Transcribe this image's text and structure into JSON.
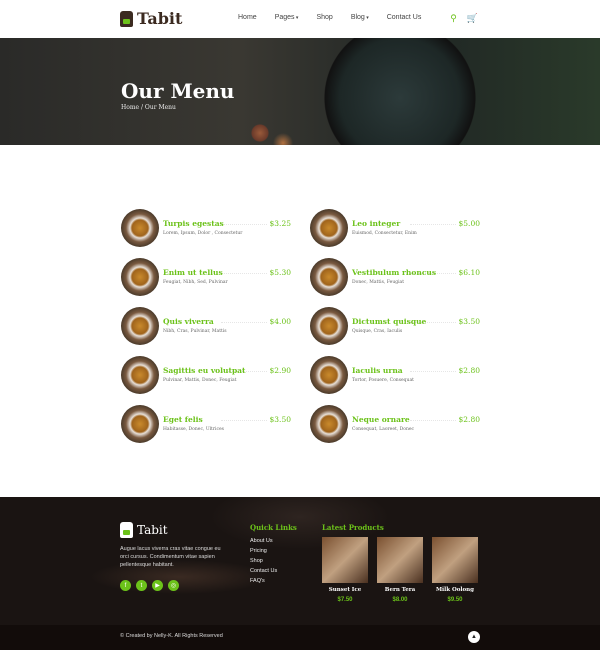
{
  "header": {
    "brand": "Tabit",
    "nav": [
      "Home",
      "Pages",
      "Shop",
      "Blog",
      "Contact Us"
    ],
    "icons": [
      "search-icon",
      "cart-icon"
    ]
  },
  "hero": {
    "title": "Our Menu",
    "breadcrumb": "Home / Our Menu"
  },
  "menu": [
    {
      "name": "Turpis egestas",
      "price": "$3.25",
      "desc": "Lorem, Ipsum, Dolor , Consectetur"
    },
    {
      "name": "Leo integer",
      "price": "$5.00",
      "desc": "Euismod, Consectetur, Enim"
    },
    {
      "name": "Enim ut tellus",
      "price": "$5.30",
      "desc": "Feugiat, Nibh, Sed, Pulvinar"
    },
    {
      "name": "Vestibulum rhoncus",
      "price": "$6.10",
      "desc": "Donec, Mattis, Feugiat"
    },
    {
      "name": "Quis viverra",
      "price": "$4.00",
      "desc": "Nibh, Cras, Pulvinar, Mattis"
    },
    {
      "name": "Dictumst quisque",
      "price": "$3.50",
      "desc": "Quisque, Cras, Iaculis"
    },
    {
      "name": "Sagittis eu volutpat",
      "price": "$2.90",
      "desc": "Pulvinar, Mattis, Donec, Feugiat"
    },
    {
      "name": "Iaculis urna",
      "price": "$2.80",
      "desc": "Tortor, Posuere, Consequat"
    },
    {
      "name": "Eget felis",
      "price": "$3.50",
      "desc": "Habitasse, Donec, Ultrices"
    },
    {
      "name": "Neque ornare",
      "price": "$2.80",
      "desc": "Consequat, Laoreet, Donec"
    }
  ],
  "footer": {
    "brand": "Tabit",
    "text": "Augue lacus viverra cras vitae congue eu orci cursus. Condimentum vitae sapien pellentesque habitant.",
    "quick_title": "Quick Links",
    "links": [
      "About Us",
      "Pricing",
      "Shop",
      "Contact Us",
      "FAQ's"
    ],
    "products_title": "Latest Products",
    "products": [
      {
        "name": "Sunset Ice",
        "price": "$7.50"
      },
      {
        "name": "Bern Tera",
        "price": "$8.00"
      },
      {
        "name": "Milk Oolong",
        "price": "$9.50"
      }
    ],
    "copyright": "© Created by Nelly-K. All Rights Reserved"
  },
  "colors": {
    "accent": "#6cc21a",
    "brand": "#3b2a20"
  }
}
